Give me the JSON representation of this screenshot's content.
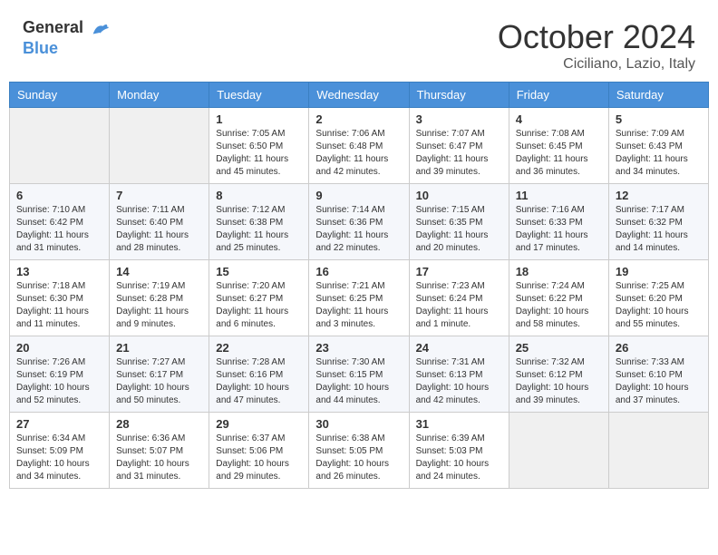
{
  "header": {
    "logo_general": "General",
    "logo_blue": "Blue",
    "month": "October 2024",
    "location": "Ciciliano, Lazio, Italy"
  },
  "days_of_week": [
    "Sunday",
    "Monday",
    "Tuesday",
    "Wednesday",
    "Thursday",
    "Friday",
    "Saturday"
  ],
  "weeks": [
    [
      {
        "day": "",
        "info": ""
      },
      {
        "day": "",
        "info": ""
      },
      {
        "day": "1",
        "info": "Sunrise: 7:05 AM\nSunset: 6:50 PM\nDaylight: 11 hours and 45 minutes."
      },
      {
        "day": "2",
        "info": "Sunrise: 7:06 AM\nSunset: 6:48 PM\nDaylight: 11 hours and 42 minutes."
      },
      {
        "day": "3",
        "info": "Sunrise: 7:07 AM\nSunset: 6:47 PM\nDaylight: 11 hours and 39 minutes."
      },
      {
        "day": "4",
        "info": "Sunrise: 7:08 AM\nSunset: 6:45 PM\nDaylight: 11 hours and 36 minutes."
      },
      {
        "day": "5",
        "info": "Sunrise: 7:09 AM\nSunset: 6:43 PM\nDaylight: 11 hours and 34 minutes."
      }
    ],
    [
      {
        "day": "6",
        "info": "Sunrise: 7:10 AM\nSunset: 6:42 PM\nDaylight: 11 hours and 31 minutes."
      },
      {
        "day": "7",
        "info": "Sunrise: 7:11 AM\nSunset: 6:40 PM\nDaylight: 11 hours and 28 minutes."
      },
      {
        "day": "8",
        "info": "Sunrise: 7:12 AM\nSunset: 6:38 PM\nDaylight: 11 hours and 25 minutes."
      },
      {
        "day": "9",
        "info": "Sunrise: 7:14 AM\nSunset: 6:36 PM\nDaylight: 11 hours and 22 minutes."
      },
      {
        "day": "10",
        "info": "Sunrise: 7:15 AM\nSunset: 6:35 PM\nDaylight: 11 hours and 20 minutes."
      },
      {
        "day": "11",
        "info": "Sunrise: 7:16 AM\nSunset: 6:33 PM\nDaylight: 11 hours and 17 minutes."
      },
      {
        "day": "12",
        "info": "Sunrise: 7:17 AM\nSunset: 6:32 PM\nDaylight: 11 hours and 14 minutes."
      }
    ],
    [
      {
        "day": "13",
        "info": "Sunrise: 7:18 AM\nSunset: 6:30 PM\nDaylight: 11 hours and 11 minutes."
      },
      {
        "day": "14",
        "info": "Sunrise: 7:19 AM\nSunset: 6:28 PM\nDaylight: 11 hours and 9 minutes."
      },
      {
        "day": "15",
        "info": "Sunrise: 7:20 AM\nSunset: 6:27 PM\nDaylight: 11 hours and 6 minutes."
      },
      {
        "day": "16",
        "info": "Sunrise: 7:21 AM\nSunset: 6:25 PM\nDaylight: 11 hours and 3 minutes."
      },
      {
        "day": "17",
        "info": "Sunrise: 7:23 AM\nSunset: 6:24 PM\nDaylight: 11 hours and 1 minute."
      },
      {
        "day": "18",
        "info": "Sunrise: 7:24 AM\nSunset: 6:22 PM\nDaylight: 10 hours and 58 minutes."
      },
      {
        "day": "19",
        "info": "Sunrise: 7:25 AM\nSunset: 6:20 PM\nDaylight: 10 hours and 55 minutes."
      }
    ],
    [
      {
        "day": "20",
        "info": "Sunrise: 7:26 AM\nSunset: 6:19 PM\nDaylight: 10 hours and 52 minutes."
      },
      {
        "day": "21",
        "info": "Sunrise: 7:27 AM\nSunset: 6:17 PM\nDaylight: 10 hours and 50 minutes."
      },
      {
        "day": "22",
        "info": "Sunrise: 7:28 AM\nSunset: 6:16 PM\nDaylight: 10 hours and 47 minutes."
      },
      {
        "day": "23",
        "info": "Sunrise: 7:30 AM\nSunset: 6:15 PM\nDaylight: 10 hours and 44 minutes."
      },
      {
        "day": "24",
        "info": "Sunrise: 7:31 AM\nSunset: 6:13 PM\nDaylight: 10 hours and 42 minutes."
      },
      {
        "day": "25",
        "info": "Sunrise: 7:32 AM\nSunset: 6:12 PM\nDaylight: 10 hours and 39 minutes."
      },
      {
        "day": "26",
        "info": "Sunrise: 7:33 AM\nSunset: 6:10 PM\nDaylight: 10 hours and 37 minutes."
      }
    ],
    [
      {
        "day": "27",
        "info": "Sunrise: 6:34 AM\nSunset: 5:09 PM\nDaylight: 10 hours and 34 minutes."
      },
      {
        "day": "28",
        "info": "Sunrise: 6:36 AM\nSunset: 5:07 PM\nDaylight: 10 hours and 31 minutes."
      },
      {
        "day": "29",
        "info": "Sunrise: 6:37 AM\nSunset: 5:06 PM\nDaylight: 10 hours and 29 minutes."
      },
      {
        "day": "30",
        "info": "Sunrise: 6:38 AM\nSunset: 5:05 PM\nDaylight: 10 hours and 26 minutes."
      },
      {
        "day": "31",
        "info": "Sunrise: 6:39 AM\nSunset: 5:03 PM\nDaylight: 10 hours and 24 minutes."
      },
      {
        "day": "",
        "info": ""
      },
      {
        "day": "",
        "info": ""
      }
    ]
  ]
}
